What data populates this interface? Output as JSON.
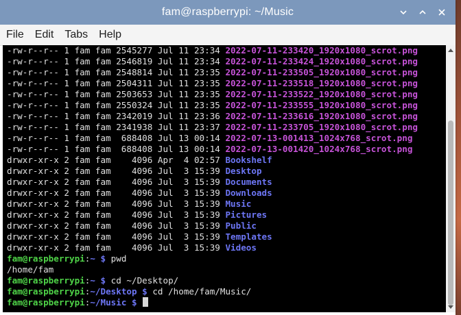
{
  "window": {
    "title": "fam@raspberrypi: ~/Music"
  },
  "menu": [
    "File",
    "Edit",
    "Tabs",
    "Help"
  ],
  "listing_files": [
    {
      "meta": "-rw-r--r-- 1 fam fam 2545277 Jul 11 23:34 ",
      "name": "2022-07-11-233420_1920x1080_scrot.png"
    },
    {
      "meta": "-rw-r--r-- 1 fam fam 2546819 Jul 11 23:34 ",
      "name": "2022-07-11-233424_1920x1080_scrot.png"
    },
    {
      "meta": "-rw-r--r-- 1 fam fam 2548814 Jul 11 23:35 ",
      "name": "2022-07-11-233505_1920x1080_scrot.png"
    },
    {
      "meta": "-rw-r--r-- 1 fam fam 2504311 Jul 11 23:35 ",
      "name": "2022-07-11-233518_1920x1080_scrot.png"
    },
    {
      "meta": "-rw-r--r-- 1 fam fam 2503653 Jul 11 23:35 ",
      "name": "2022-07-11-233522_1920x1080_scrot.png"
    },
    {
      "meta": "-rw-r--r-- 1 fam fam 2550324 Jul 11 23:35 ",
      "name": "2022-07-11-233555_1920x1080_scrot.png"
    },
    {
      "meta": "-rw-r--r-- 1 fam fam 2342019 Jul 11 23:36 ",
      "name": "2022-07-11-233616_1920x1080_scrot.png"
    },
    {
      "meta": "-rw-r--r-- 1 fam fam 2341938 Jul 11 23:37 ",
      "name": "2022-07-11-233705_1920x1080_scrot.png"
    },
    {
      "meta": "-rw-r--r-- 1 fam fam  688408 Jul 13 00:14 ",
      "name": "2022-07-13-001413_1024x768_scrot.png"
    },
    {
      "meta": "-rw-r--r-- 1 fam fam  688408 Jul 13 00:14 ",
      "name": "2022-07-13-001420_1024x768_scrot.png"
    }
  ],
  "listing_dirs": [
    {
      "meta": "drwxr-xr-x 2 fam fam    4096 Apr  4 02:57 ",
      "name": "Bookshelf"
    },
    {
      "meta": "drwxr-xr-x 2 fam fam    4096 Jul  3 15:39 ",
      "name": "Desktop"
    },
    {
      "meta": "drwxr-xr-x 2 fam fam    4096 Jul  3 15:39 ",
      "name": "Documents"
    },
    {
      "meta": "drwxr-xr-x 2 fam fam    4096 Jul  3 15:39 ",
      "name": "Downloads"
    },
    {
      "meta": "drwxr-xr-x 2 fam fam    4096 Jul  3 15:39 ",
      "name": "Music"
    },
    {
      "meta": "drwxr-xr-x 2 fam fam    4096 Jul  3 15:39 ",
      "name": "Pictures"
    },
    {
      "meta": "drwxr-xr-x 2 fam fam    4096 Jul  3 15:39 ",
      "name": "Public"
    },
    {
      "meta": "drwxr-xr-x 2 fam fam    4096 Jul  3 15:39 ",
      "name": "Templates"
    },
    {
      "meta": "drwxr-xr-x 2 fam fam    4096 Jul  3 15:39 ",
      "name": "Videos"
    }
  ],
  "session": [
    {
      "type": "prompt",
      "user": "fam@raspberrypi",
      "sep": ":",
      "path": "~",
      "sym": " $ ",
      "cmd": "pwd"
    },
    {
      "type": "output",
      "text": "/home/fam"
    },
    {
      "type": "prompt",
      "user": "fam@raspberrypi",
      "sep": ":",
      "path": "~",
      "sym": " $ ",
      "cmd": "cd ~/Desktop/"
    },
    {
      "type": "prompt",
      "user": "fam@raspberrypi",
      "sep": ":",
      "path": "~/Desktop",
      "sym": " $ ",
      "cmd": "cd /home/fam/Music/"
    },
    {
      "type": "prompt",
      "user": "fam@raspberrypi",
      "sep": ":",
      "path": "~/Music",
      "sym": " $ ",
      "cmd": "",
      "cursor": true
    }
  ],
  "colors": {
    "titlebar": "#7c98bc",
    "file": "#c653d8",
    "directory": "#6d76f5",
    "user": "#4fd448",
    "background": "#000000"
  },
  "icons": [
    "minimize-icon",
    "maximize-icon",
    "close-icon"
  ]
}
